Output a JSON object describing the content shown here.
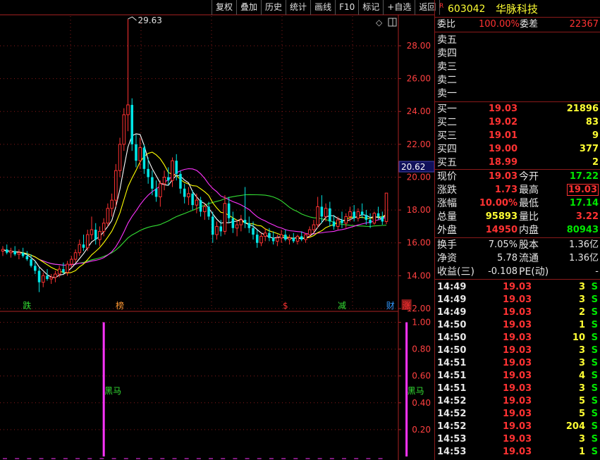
{
  "toolbar": [
    "复权",
    "叠加",
    "历史",
    "统计",
    "画线",
    "F10",
    "标记",
    "+自选",
    "返回"
  ],
  "stock": {
    "flag": "R",
    "code": "603042",
    "name": "华脉科技"
  },
  "wb": {
    "label": "委比",
    "pct": "100.00%",
    "diff_label": "委差",
    "diff": "22367"
  },
  "sell": [
    {
      "label": "卖五"
    },
    {
      "label": "卖四"
    },
    {
      "label": "卖三"
    },
    {
      "label": "卖二"
    },
    {
      "label": "卖一"
    }
  ],
  "buy": [
    {
      "label": "买一",
      "price": "19.03",
      "vol": "21896"
    },
    {
      "label": "买二",
      "price": "19.02",
      "vol": "83"
    },
    {
      "label": "买三",
      "price": "19.01",
      "vol": "9"
    },
    {
      "label": "买四",
      "price": "19.00",
      "vol": "377"
    },
    {
      "label": "买五",
      "price": "18.99",
      "vol": "2"
    }
  ],
  "quote": [
    {
      "l1": "现价",
      "v1": "19.03",
      "c1": "red",
      "l2": "今开",
      "v2": "17.22",
      "c2": "green"
    },
    {
      "l1": "涨跌",
      "v1": "1.73",
      "c1": "red",
      "l2": "最高",
      "v2": "19.03",
      "c2": "red"
    },
    {
      "l1": "涨幅",
      "v1": "10.00%",
      "c1": "red",
      "l2": "最低",
      "v2": "17.14",
      "c2": "green"
    },
    {
      "l1": "总量",
      "v1": "95893",
      "c1": "yellow",
      "l2": "量比",
      "v2": "3.22",
      "c2": "red"
    },
    {
      "l1": "外盘",
      "v1": "14950",
      "c1": "red",
      "l2": "内盘",
      "v2": "80943",
      "c2": "green"
    }
  ],
  "fin": [
    {
      "l1": "换手",
      "v1": "7.05%",
      "l2": "股本",
      "v2": "1.36亿"
    },
    {
      "l1": "净资",
      "v1": "5.78",
      "l2": "流通",
      "v2": "1.36亿"
    },
    {
      "l1": "收益(三)",
      "v1": "-0.108",
      "l2": "PE(动)",
      "v2": "-"
    }
  ],
  "ticks": [
    {
      "time": "14:49",
      "price": "19.03",
      "vol": "3",
      "side": "S"
    },
    {
      "time": "14:49",
      "price": "19.03",
      "vol": "3",
      "side": "S"
    },
    {
      "time": "14:49",
      "price": "19.03",
      "vol": "2",
      "side": "S"
    },
    {
      "time": "14:50",
      "price": "19.03",
      "vol": "1",
      "side": "S"
    },
    {
      "time": "14:50",
      "price": "19.03",
      "vol": "10",
      "side": "S"
    },
    {
      "time": "14:50",
      "price": "19.03",
      "vol": "3",
      "side": "S"
    },
    {
      "time": "14:51",
      "price": "19.03",
      "vol": "3",
      "side": "S"
    },
    {
      "time": "14:51",
      "price": "19.03",
      "vol": "4",
      "side": "S"
    },
    {
      "time": "14:51",
      "price": "19.03",
      "vol": "3",
      "side": "S"
    },
    {
      "time": "14:52",
      "price": "19.03",
      "vol": "5",
      "side": "S"
    },
    {
      "time": "14:52",
      "price": "19.03",
      "vol": "5",
      "side": "S"
    },
    {
      "time": "14:52",
      "price": "19.03",
      "vol": "204",
      "side": "S"
    },
    {
      "time": "14:53",
      "price": "19.03",
      "vol": "3",
      "side": "S"
    },
    {
      "time": "14:53",
      "price": "19.03",
      "vol": "1",
      "side": "S"
    }
  ],
  "colors": {
    "up": "#ff3232",
    "down": "#00e6e6",
    "ma5": "#ffffff",
    "ma10": "#ffff00",
    "ma20": "#ff33ff",
    "ma60": "#33dd33",
    "signal": "#ff33ff",
    "grid": "#8a1a1a"
  },
  "chart_data": {
    "type": "candlestick",
    "price_axis": {
      "ylim": [
        12,
        29.8
      ],
      "ticks": [
        "12.00",
        "14.00",
        "16.00",
        "18.00",
        "20.00",
        "22.00",
        "24.00",
        "26.00",
        "28.00"
      ],
      "current": "20.62"
    },
    "peak_label": "29.63",
    "candles": [
      [
        15.5,
        15.8,
        15.2,
        15.6
      ],
      [
        15.6,
        15.9,
        15.3,
        15.4
      ],
      [
        15.4,
        15.7,
        15.1,
        15.5
      ],
      [
        15.5,
        15.8,
        15.2,
        15.3
      ],
      [
        15.3,
        15.6,
        15.0,
        15.4
      ],
      [
        15.4,
        15.7,
        15.1,
        15.2
      ],
      [
        15.2,
        15.5,
        14.9,
        15.0
      ],
      [
        15.0,
        15.3,
        14.5,
        14.6
      ],
      [
        14.6,
        14.9,
        14.1,
        14.3
      ],
      [
        14.3,
        14.5,
        13.0,
        13.6
      ],
      [
        13.6,
        14.2,
        13.3,
        14.0
      ],
      [
        14.0,
        14.4,
        13.7,
        13.8
      ],
      [
        13.8,
        14.1,
        13.5,
        13.9
      ],
      [
        13.9,
        14.3,
        13.6,
        14.1
      ],
      [
        14.1,
        14.6,
        13.9,
        14.4
      ],
      [
        14.4,
        14.8,
        14.1,
        14.2
      ],
      [
        14.2,
        14.9,
        14.0,
        14.7
      ],
      [
        14.7,
        15.2,
        14.5,
        15.0
      ],
      [
        15.0,
        15.6,
        14.8,
        15.4
      ],
      [
        15.4,
        16.2,
        15.2,
        15.9
      ],
      [
        15.9,
        16.5,
        15.5,
        15.7
      ],
      [
        15.7,
        16.8,
        15.5,
        16.5
      ],
      [
        16.5,
        17.6,
        16.2,
        16.8
      ],
      [
        16.8,
        17.2,
        15.9,
        16.2
      ],
      [
        16.2,
        17.0,
        15.8,
        16.7
      ],
      [
        16.7,
        17.5,
        16.4,
        17.2
      ],
      [
        17.2,
        18.4,
        17.0,
        18.1
      ],
      [
        18.1,
        19.0,
        17.6,
        18.6
      ],
      [
        18.6,
        20.8,
        18.2,
        20.4
      ],
      [
        20.4,
        22.4,
        20.0,
        22.0
      ],
      [
        22.0,
        24.2,
        21.6,
        23.8
      ],
      [
        23.8,
        29.63,
        22.8,
        24.4
      ],
      [
        24.4,
        24.8,
        21.6,
        22.0
      ],
      [
        22.0,
        22.6,
        20.6,
        21.0
      ],
      [
        21.0,
        22.4,
        20.5,
        21.8
      ],
      [
        21.8,
        22.0,
        20.2,
        20.5
      ],
      [
        20.5,
        21.2,
        19.6,
        20.0
      ],
      [
        20.0,
        20.4,
        18.9,
        19.3
      ],
      [
        19.3,
        19.8,
        18.5,
        18.8
      ],
      [
        18.8,
        19.8,
        18.2,
        19.6
      ],
      [
        19.6,
        20.4,
        19.2,
        20.0
      ],
      [
        20.0,
        20.6,
        19.5,
        19.8
      ],
      [
        19.8,
        21.2,
        19.4,
        21.0
      ],
      [
        21.0,
        21.4,
        19.8,
        20.2
      ],
      [
        20.2,
        20.4,
        19.0,
        19.3
      ],
      [
        19.3,
        19.6,
        18.4,
        18.8
      ],
      [
        18.8,
        19.4,
        18.3,
        19.0
      ],
      [
        19.0,
        19.2,
        18.0,
        18.3
      ],
      [
        18.3,
        19.0,
        17.8,
        18.6
      ],
      [
        18.6,
        18.8,
        17.6,
        17.9
      ],
      [
        17.9,
        18.4,
        17.4,
        18.2
      ],
      [
        18.2,
        18.5,
        17.4,
        17.6
      ],
      [
        17.6,
        17.9,
        16.0,
        16.5
      ],
      [
        16.5,
        17.3,
        16.2,
        17.0
      ],
      [
        17.0,
        17.4,
        16.4,
        16.7
      ],
      [
        16.7,
        18.9,
        16.5,
        18.4
      ],
      [
        18.4,
        18.8,
        17.2,
        17.5
      ],
      [
        17.5,
        17.9,
        16.6,
        16.9
      ],
      [
        16.9,
        17.4,
        16.4,
        17.1
      ],
      [
        17.1,
        17.7,
        16.7,
        17.4
      ],
      [
        17.4,
        19.4,
        16.9,
        17.2
      ],
      [
        17.2,
        17.6,
        16.6,
        16.9
      ],
      [
        16.9,
        17.3,
        16.2,
        16.5
      ],
      [
        16.5,
        16.8,
        15.7,
        16.0
      ],
      [
        16.0,
        16.6,
        15.8,
        16.4
      ],
      [
        16.4,
        16.9,
        16.1,
        16.6
      ],
      [
        16.6,
        16.9,
        16.1,
        16.3
      ],
      [
        16.3,
        16.7,
        15.9,
        16.1
      ],
      [
        16.1,
        16.5,
        15.8,
        16.3
      ],
      [
        16.3,
        16.8,
        16.0,
        16.5
      ],
      [
        16.5,
        16.8,
        16.1,
        16.2
      ],
      [
        16.2,
        16.5,
        15.9,
        16.3
      ],
      [
        16.3,
        16.6,
        16.0,
        16.1
      ],
      [
        16.1,
        16.5,
        15.9,
        16.4
      ],
      [
        16.4,
        16.7,
        16.1,
        16.2
      ],
      [
        16.2,
        16.6,
        16.0,
        16.5
      ],
      [
        16.5,
        17.0,
        16.3,
        16.8
      ],
      [
        16.8,
        17.4,
        16.6,
        17.1
      ],
      [
        17.1,
        18.8,
        16.9,
        18.2
      ],
      [
        18.2,
        18.9,
        17.2,
        17.6
      ],
      [
        17.6,
        18.4,
        17.3,
        18.1
      ],
      [
        18.1,
        18.5,
        17.0,
        17.3
      ],
      [
        17.3,
        17.7,
        16.8,
        17.0
      ],
      [
        17.0,
        17.6,
        16.8,
        17.4
      ],
      [
        17.4,
        17.9,
        16.9,
        17.2
      ],
      [
        17.2,
        17.8,
        16.9,
        17.6
      ],
      [
        17.6,
        18.2,
        17.3,
        17.9
      ],
      [
        17.9,
        18.3,
        17.3,
        17.5
      ],
      [
        17.5,
        18.1,
        17.3,
        17.9
      ],
      [
        17.9,
        18.4,
        17.5,
        17.7
      ],
      [
        17.7,
        18.0,
        17.1,
        17.4
      ],
      [
        17.4,
        17.8,
        16.9,
        17.2
      ],
      [
        17.2,
        17.9,
        17.1,
        17.8
      ],
      [
        17.8,
        18.2,
        17.4,
        17.6
      ],
      [
        17.6,
        17.9,
        17.1,
        17.3
      ],
      [
        17.3,
        19.03,
        17.14,
        19.03
      ]
    ],
    "markers": [
      {
        "index": 6,
        "text": "跌",
        "color": "#33dd33"
      },
      {
        "index": 29,
        "text": "榜",
        "color": "#ff9933"
      },
      {
        "index": 70,
        "text": "$",
        "color": "#ff3232"
      },
      {
        "index": 84,
        "text": "减",
        "color": "#33dd33"
      },
      {
        "index": 96,
        "text": "财",
        "color": "#3399ff"
      },
      {
        "index": 100,
        "text": "涨",
        "color": "#ff3232",
        "bg": "#8a1a1a"
      }
    ],
    "indicator": {
      "ylim": [
        0,
        1.05
      ],
      "ticks": [
        "0.20",
        "0.40",
        "0.60",
        "0.80",
        "1.00"
      ],
      "spikes": [
        {
          "index": 25,
          "value": 1.0,
          "label": "黑马"
        },
        {
          "index": 100,
          "value": 1.0,
          "label": "黑马"
        }
      ]
    }
  }
}
